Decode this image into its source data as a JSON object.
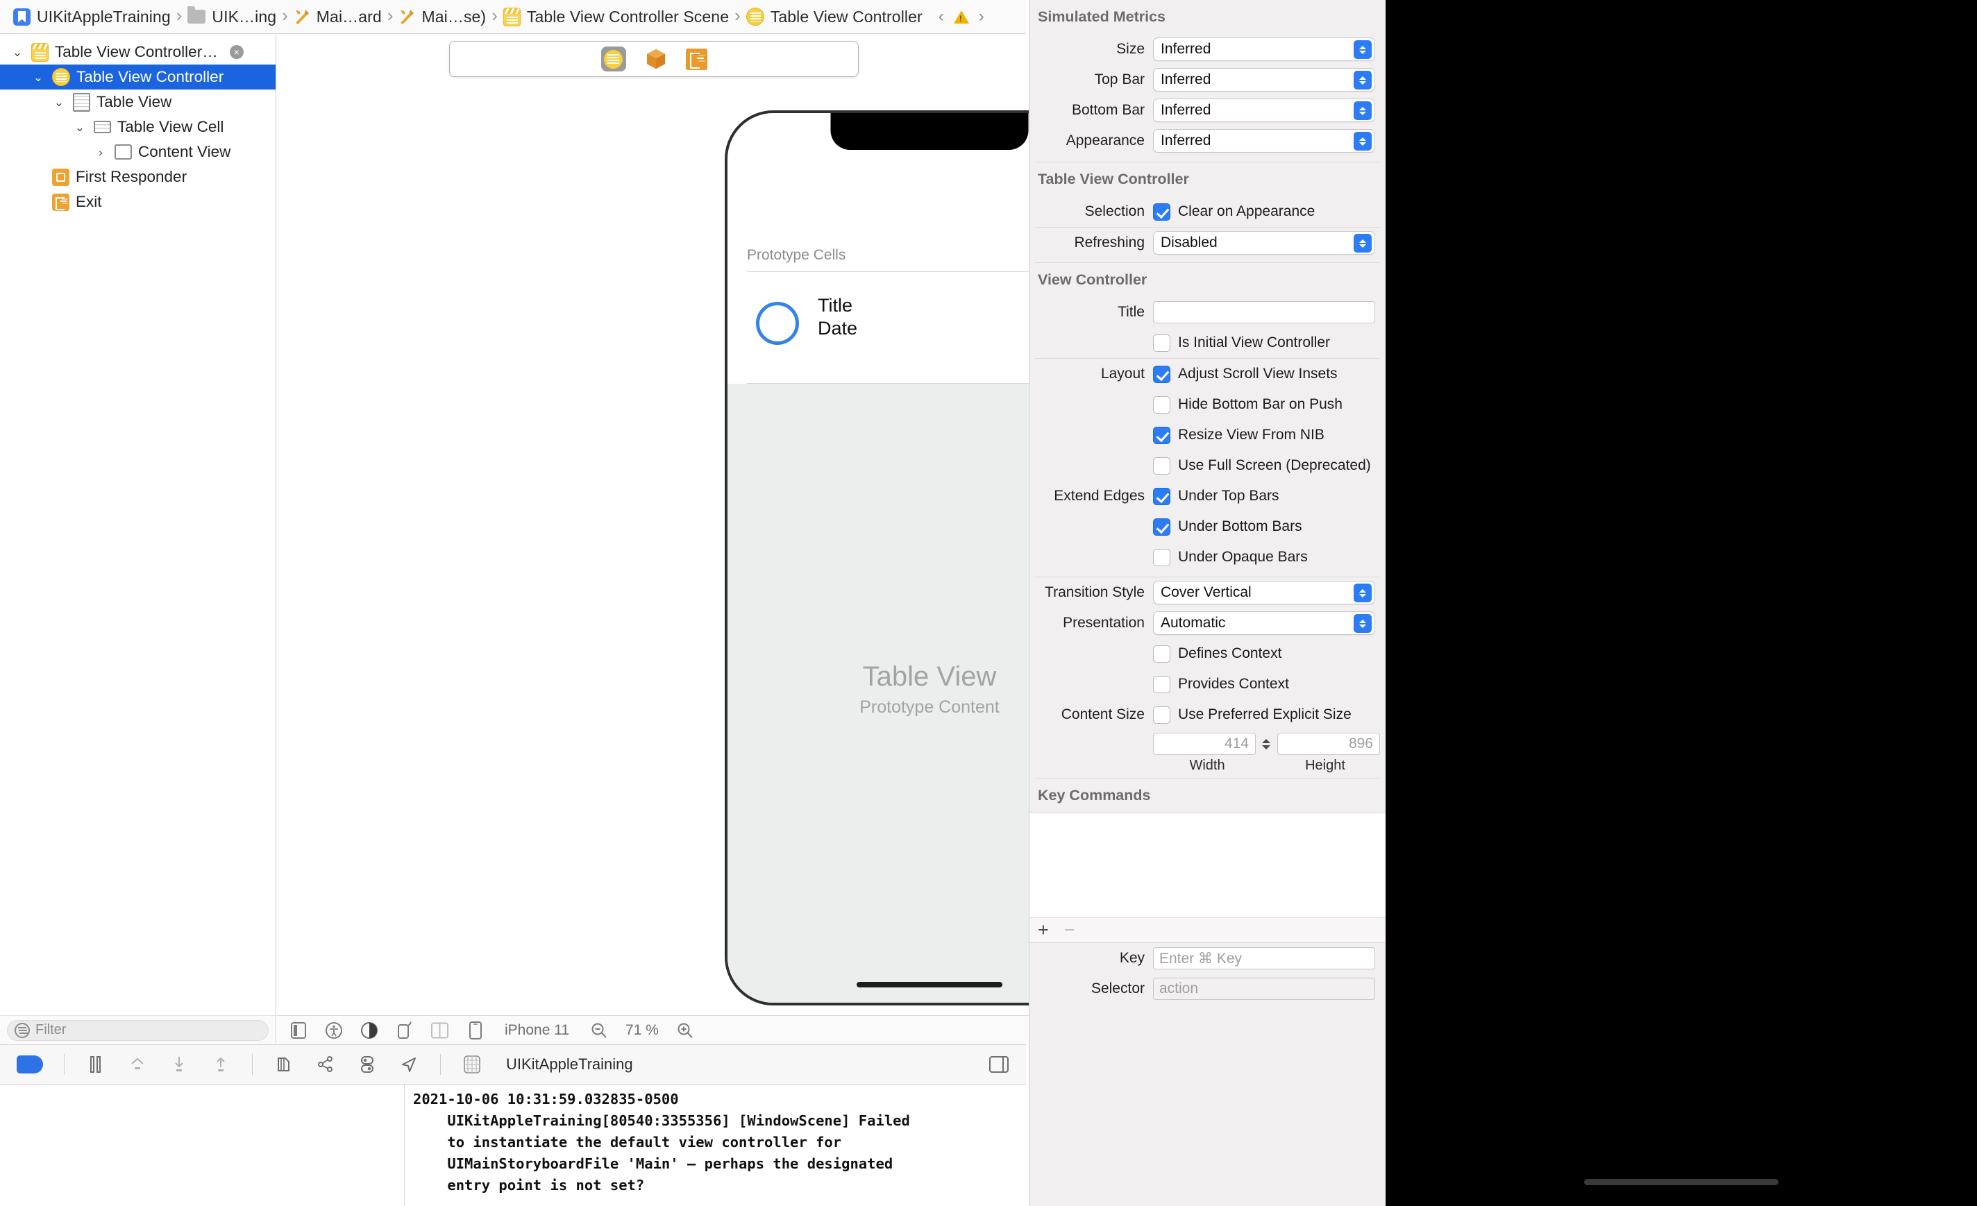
{
  "breadcrumb": {
    "items": [
      {
        "label": "UIKitAppleTraining",
        "icon": "xcodeproj-icon"
      },
      {
        "label": "UIK…ing",
        "icon": "folder-icon"
      },
      {
        "label": "Mai…ard",
        "icon": "storyboard-icon"
      },
      {
        "label": "Mai…se)",
        "icon": "storyboard-icon"
      },
      {
        "label": "Table View Controller Scene",
        "icon": "scene-icon"
      },
      {
        "label": "Table View Controller",
        "icon": "view-controller-icon"
      }
    ],
    "warning_count": "",
    "back_arrow": "‹",
    "forward_arrow": "›"
  },
  "outline": {
    "rows": [
      {
        "label": "Table View Controller…",
        "icon": "scene-icon",
        "indent": 0,
        "disclosure": "open",
        "selected": false,
        "badge": "×"
      },
      {
        "label": "Table View Controller",
        "icon": "view-controller-icon",
        "indent": 1,
        "disclosure": "open",
        "selected": true,
        "badge": ""
      },
      {
        "label": "Table View",
        "icon": "table-view-icon",
        "indent": 2,
        "disclosure": "open",
        "selected": false,
        "badge": ""
      },
      {
        "label": "Table View Cell",
        "icon": "table-view-cell-icon",
        "indent": 3,
        "disclosure": "open",
        "selected": false,
        "badge": ""
      },
      {
        "label": "Content View",
        "icon": "view-icon",
        "indent": 4,
        "disclosure": "closed",
        "selected": false,
        "badge": ""
      },
      {
        "label": "First Responder",
        "icon": "first-responder-icon",
        "indent": 1,
        "disclosure": "none",
        "selected": false,
        "badge": ""
      },
      {
        "label": "Exit",
        "icon": "exit-icon",
        "indent": 1,
        "disclosure": "none",
        "selected": false,
        "badge": ""
      }
    ],
    "filter_placeholder": "Filter"
  },
  "canvas": {
    "scene_toolbar_icons": [
      "view-controller-icon",
      "first-responder-cube-icon",
      "exit-icon"
    ],
    "prototype_cells_label": "Prototype Cells",
    "cell_title": "Title",
    "cell_date": "Date",
    "table_view_title": "Table View",
    "table_view_subtitle": "Prototype Content",
    "toolbar": {
      "device_name": "iPhone 11",
      "zoom_level": "71 %",
      "left_icons": [
        "view-as-icon",
        "accessibility-icon",
        "appearance-icon",
        "orientation-icon",
        "split-view-icon",
        "device-icon"
      ],
      "zoom_out_icon": "zoom-out-icon",
      "zoom_in_icon": "zoom-in-icon",
      "right_icons": [
        "update-frames-icon",
        "embed-in-icon",
        "align-icon",
        "add-constraints-icon",
        "resolve-issues-icon"
      ]
    }
  },
  "debug_bar": {
    "scheme_name": "UIKitAppleTraining",
    "icons": [
      "debug-toggle-icon",
      "pause-icon",
      "step-over-icon",
      "step-into-icon",
      "step-out-icon",
      "view-hierarchy-icon",
      "memory-graph-icon",
      "environment-overrides-icon",
      "location-icon",
      "grid-icon"
    ],
    "right_icons": [
      "console-toggle-icon"
    ]
  },
  "console": {
    "log": "2021-10-06 10:31:59.032835-0500\n    UIKitAppleTraining[80540:3355356] [WindowScene] Failed\n    to instantiate the default view controller for\n    UIMainStoryboardFile 'Main' — perhaps the designated\n    entry point is not set?"
  },
  "inspector": {
    "simulated_metrics": {
      "title": "Simulated Metrics",
      "rows": [
        {
          "label": "Size",
          "value": "Inferred"
        },
        {
          "label": "Top Bar",
          "value": "Inferred"
        },
        {
          "label": "Bottom Bar",
          "value": "Inferred"
        },
        {
          "label": "Appearance",
          "value": "Inferred"
        }
      ]
    },
    "table_view_controller": {
      "title": "Table View Controller",
      "selection_label": "Selection",
      "selection_checkbox_label": "Clear on Appearance",
      "selection_checked": true,
      "refreshing_label": "Refreshing",
      "refreshing_value": "Disabled"
    },
    "view_controller": {
      "title": "View Controller",
      "title_label": "Title",
      "title_value": "",
      "is_initial_label": "Is Initial View Controller",
      "is_initial_checked": false,
      "layout_label": "Layout",
      "layout_items": [
        {
          "label": "Adjust Scroll View Insets",
          "checked": true
        },
        {
          "label": "Hide Bottom Bar on Push",
          "checked": false
        },
        {
          "label": "Resize View From NIB",
          "checked": true
        },
        {
          "label": "Use Full Screen (Deprecated)",
          "checked": false
        }
      ],
      "extend_edges_label": "Extend Edges",
      "extend_edges_items": [
        {
          "label": "Under Top Bars",
          "checked": true
        },
        {
          "label": "Under Bottom Bars",
          "checked": true
        },
        {
          "label": "Under Opaque Bars",
          "checked": false
        }
      ],
      "transition_style_label": "Transition Style",
      "transition_style_value": "Cover Vertical",
      "presentation_label": "Presentation",
      "presentation_value": "Automatic",
      "context_items": [
        {
          "label": "Defines Context",
          "checked": false
        },
        {
          "label": "Provides Context",
          "checked": false
        }
      ],
      "content_size_label": "Content Size",
      "content_size_checkbox_label": "Use Preferred Explicit Size",
      "content_size_checked": false,
      "width_value": "414",
      "height_value": "896",
      "width_label": "Width",
      "height_label": "Height"
    },
    "key_commands": {
      "title": "Key Commands",
      "add_label": "+",
      "remove_label": "−",
      "key_label": "Key",
      "key_placeholder": "Enter ⌘ Key",
      "selector_label": "Selector",
      "selector_placeholder": "action"
    }
  }
}
